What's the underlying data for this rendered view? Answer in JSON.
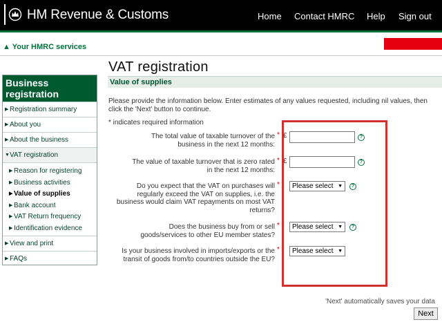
{
  "header": {
    "brand": "HM Revenue & Customs",
    "logo_icon": "crown-icon",
    "nav": [
      "Home",
      "Contact HMRC",
      "Help",
      "Sign out"
    ]
  },
  "services_link": "▲ Your HMRC services",
  "sidebar": {
    "title": "Business registration",
    "items": [
      {
        "label": "Registration summary"
      },
      {
        "label": "About you"
      },
      {
        "label": "About the business"
      },
      {
        "label": "VAT registration"
      },
      {
        "label": "View and print"
      },
      {
        "label": "FAQs"
      }
    ],
    "subitems": [
      {
        "label": "Reason for registering"
      },
      {
        "label": "Business activities"
      },
      {
        "label": "Value of supplies"
      },
      {
        "label": "Bank account"
      },
      {
        "label": "VAT Return frequency"
      },
      {
        "label": "Identification evidence"
      }
    ]
  },
  "main": {
    "title": "VAT registration",
    "section": "Value of supplies",
    "intro": "Please provide the information below. Enter estimates of any values requested, including nil values, then click the 'Next' button to continue.",
    "required_note": "* indicates required information",
    "questions": [
      {
        "label": "The total value of taxable turnover of the business in the next 12 months:",
        "value": ""
      },
      {
        "label": "The value of taxable turnover that is zero rated in the next 12 months:",
        "value": ""
      },
      {
        "label": "Do you expect that the VAT on purchases will regularly exceed the VAT on supplies, i.e. the business would claim VAT repayments on most VAT returns?",
        "selected": "Please select"
      },
      {
        "label": "Does the business buy from or sell goods/services to other EU member states?",
        "selected": "Please select"
      },
      {
        "label": "Is your business involved in imports/exports or the transit of goods from/to countries outside the EU?",
        "selected": "Please select"
      }
    ],
    "required_marker": "*",
    "currency_marker": "£",
    "help_icon": "question-icon"
  },
  "footer": {
    "autosave": "'Next' automatically saves your data",
    "next_label": "Next"
  },
  "colors": {
    "header_bg": "#000000",
    "accent_green": "#00703c",
    "highlight_red": "#d0312d",
    "alert_red": "#e4000f"
  }
}
